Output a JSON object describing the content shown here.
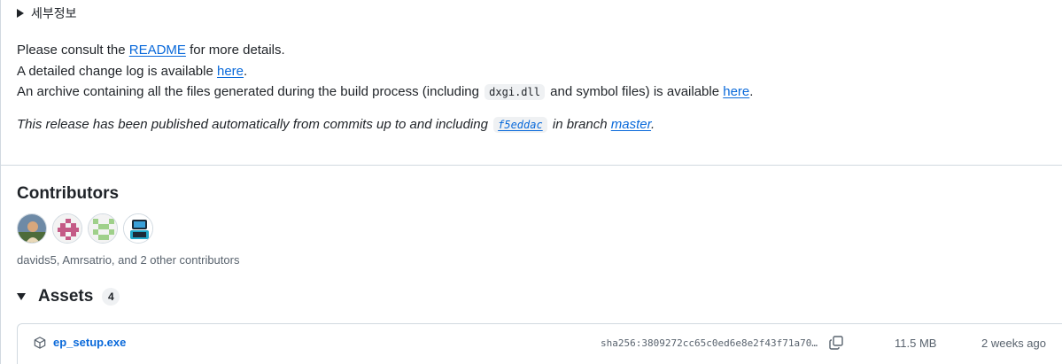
{
  "details": {
    "summary_label": "세부정보"
  },
  "notes": {
    "line1": {
      "before": "Please consult the ",
      "link": "README",
      "after": " for more details."
    },
    "line2": {
      "before": "A detailed change log is available ",
      "link": "here",
      "after": "."
    },
    "line3": {
      "before": "An archive containing all the files generated during the build process (including ",
      "code": "dxgi.dll",
      "middle": " and symbol files) is available ",
      "link": "here",
      "after": "."
    },
    "release": {
      "before": "This release has been published automatically from commits up to and including ",
      "commit": "f5eddac",
      "middle": " in branch ",
      "branch": "master",
      "after": "."
    }
  },
  "contributors": {
    "title": "Contributors",
    "summary": "davids5, Amrsatrio, and 2 other contributors",
    "avatars": [
      "davids5",
      "Amrsatrio",
      "contributor-3",
      "contributor-4"
    ]
  },
  "assets": {
    "title": "Assets",
    "count": "4",
    "items": [
      {
        "name": "ep_setup.exe",
        "sha": "sha256:3809272cc65c0ed6e8e2f43f71a70…",
        "size": "11.5 MB",
        "date": "2 weeks ago"
      }
    ]
  },
  "colors": {
    "link": "#0969da",
    "text": "#1f2328",
    "muted": "#59636e",
    "border": "#d1d9e0"
  }
}
